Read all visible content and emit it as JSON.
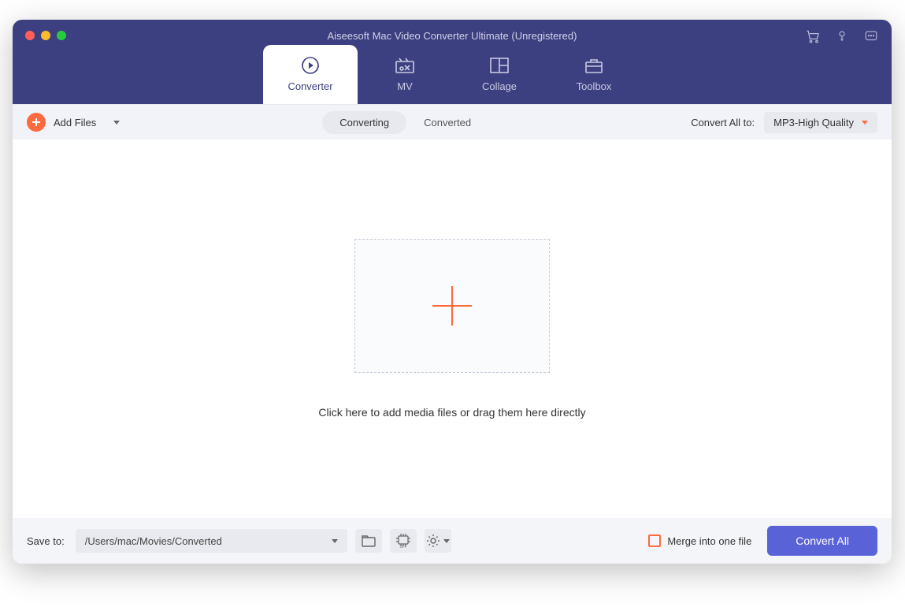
{
  "window": {
    "title": "Aiseesoft Mac Video Converter Ultimate (Unregistered)"
  },
  "tabs": {
    "converter": "Converter",
    "mv": "MV",
    "collage": "Collage",
    "toolbox": "Toolbox"
  },
  "toolbar": {
    "add_files": "Add Files",
    "segment": {
      "converting": "Converting",
      "converted": "Converted"
    },
    "convert_all_to_label": "Convert All to:",
    "format_selected": "MP3-High Quality"
  },
  "main": {
    "hint": "Click here to add media files or drag them here directly"
  },
  "footer": {
    "save_to_label": "Save to:",
    "save_path": "/Users/mac/Movies/Converted",
    "merge_label": "Merge into one file",
    "convert_all_button": "Convert All"
  }
}
